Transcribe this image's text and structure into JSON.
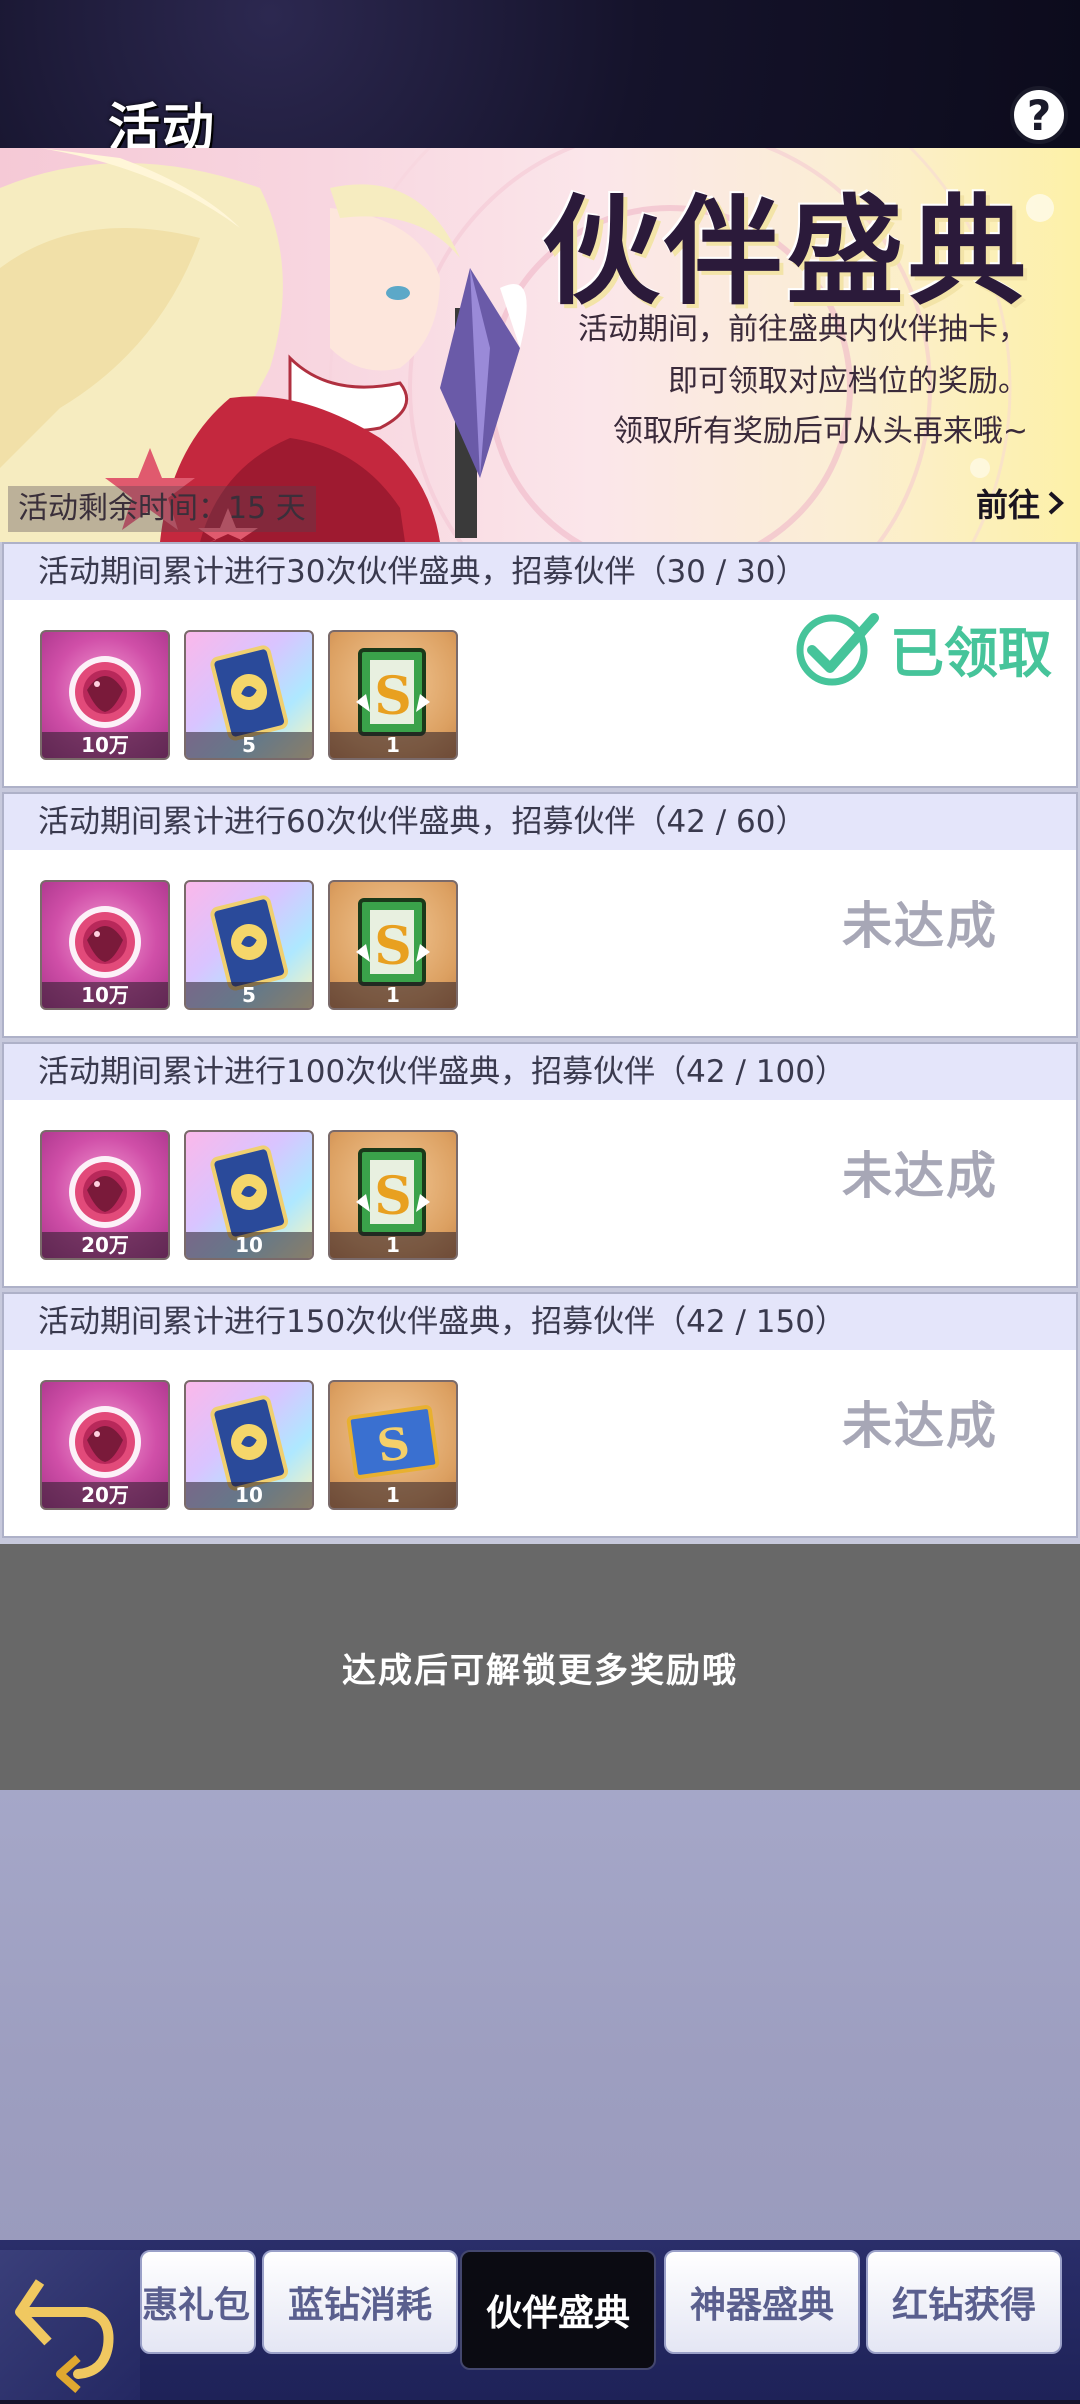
{
  "header": {
    "title": "活动",
    "help_icon": "question-mark"
  },
  "banner": {
    "title": "伙伴盛典",
    "desc_line1": "活动期间，前往盛典内伙伴抽卡，",
    "desc_line2": "即可领取对应档位的奖励。",
    "desc_line3": "领取所有奖励后可从头再来哦~",
    "remaining": "活动剩余时间：15 天",
    "goto_label": "前往"
  },
  "tasks": [
    {
      "title": "活动期间累计进行30次伙伴盛典，招募伙伴（30 / 30）",
      "rewards": [
        {
          "icon": "diamond-orb-icon",
          "count": "10万"
        },
        {
          "icon": "summon-card-icon",
          "count": "5"
        },
        {
          "icon": "s-ticket-green-icon",
          "count": "1"
        }
      ],
      "status": "已领取",
      "claimed": true
    },
    {
      "title": "活动期间累计进行60次伙伴盛典，招募伙伴（42 / 60）",
      "rewards": [
        {
          "icon": "diamond-orb-icon",
          "count": "10万"
        },
        {
          "icon": "summon-card-icon",
          "count": "5"
        },
        {
          "icon": "s-ticket-green-icon",
          "count": "1"
        }
      ],
      "status": "未达成",
      "claimed": false
    },
    {
      "title": "活动期间累计进行100次伙伴盛典，招募伙伴（42 / 100）",
      "rewards": [
        {
          "icon": "diamond-orb-icon",
          "count": "20万"
        },
        {
          "icon": "summon-card-icon",
          "count": "10"
        },
        {
          "icon": "s-ticket-green-icon",
          "count": "1"
        }
      ],
      "status": "未达成",
      "claimed": false
    },
    {
      "title": "活动期间累计进行150次伙伴盛典，招募伙伴（42 / 150）",
      "rewards": [
        {
          "icon": "diamond-orb-icon",
          "count": "20万"
        },
        {
          "icon": "summon-card-icon",
          "count": "10"
        },
        {
          "icon": "s-ticket-blue-icon",
          "count": "1"
        }
      ],
      "status": "未达成",
      "claimed": false
    }
  ],
  "unlock_hint": "达成后可解锁更多奖励哦",
  "tabs": [
    {
      "label": "惠礼包",
      "active": false
    },
    {
      "label": "蓝钻消耗",
      "active": false
    },
    {
      "label": "伙伴盛典",
      "active": true
    },
    {
      "label": "神器盛典",
      "active": false
    },
    {
      "label": "红钻获得",
      "active": false
    }
  ],
  "colors": {
    "claimed": "#46c49a",
    "pending": "#a7a7b6",
    "task_header_bg": "#e4e5fa",
    "tabbar_bg": "#1e2258"
  }
}
